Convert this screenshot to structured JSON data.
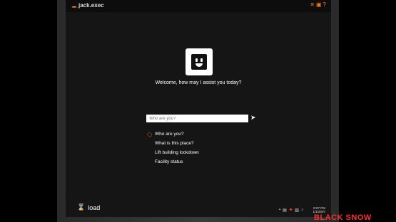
{
  "window": {
    "title": "jack.exec",
    "icons": [
      "close-icon",
      "window-icon",
      "help-icon"
    ]
  },
  "assistant": {
    "welcome": "Welcome, how may I assist you today?"
  },
  "input": {
    "placeholder": "Who are you?"
  },
  "options": [
    "Who are you?",
    "What is this place?",
    "Lift building lockdown",
    "Facility status"
  ],
  "footer": {
    "load_label": "load",
    "time": "8:07 PM",
    "date": "1/1/2007"
  },
  "watermark": "BLACK SNOW",
  "colors": {
    "accent": "#ff7a1a",
    "background": "#151515",
    "watermark": "#ff2e2e"
  }
}
